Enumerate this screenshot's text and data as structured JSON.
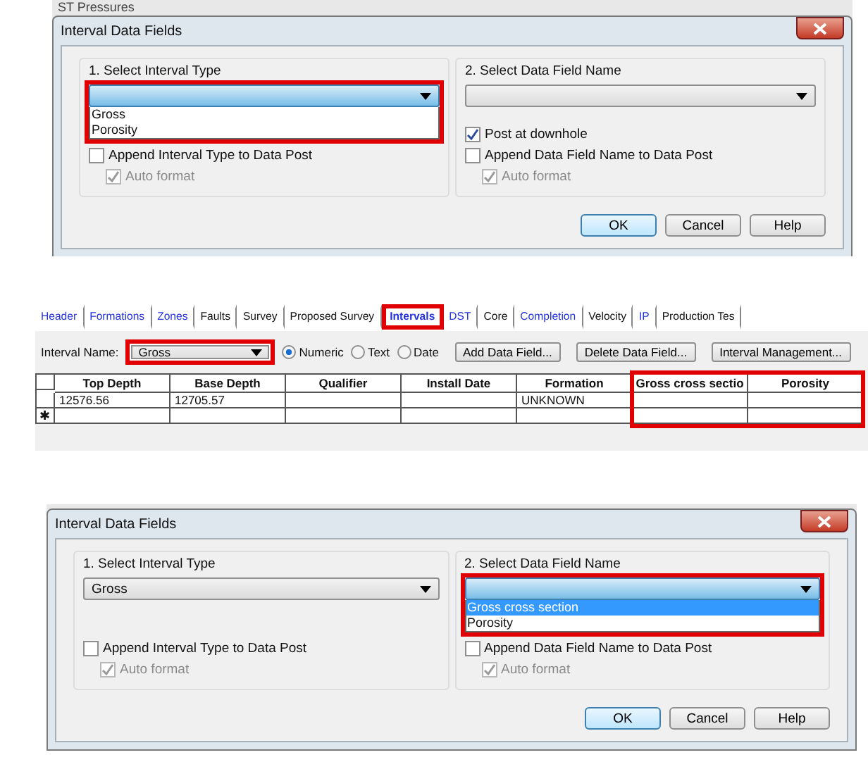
{
  "panels": [
    {
      "kind": "dialog",
      "background_label": "ST Pressures",
      "title": "Interval Data Fields",
      "groups": [
        {
          "label": "1. Select Interval Type",
          "dropdown": {
            "open": true,
            "highlighted": true,
            "options": [
              {
                "label": "Gross",
                "selected": false
              },
              {
                "label": "Porosity",
                "selected": false
              }
            ]
          },
          "checkboxes": [
            {
              "label": "Append Interval Type to Data Post",
              "checked": false,
              "disabled": false,
              "children": [
                {
                  "label": "Auto format",
                  "checked": true,
                  "disabled": true
                }
              ]
            }
          ]
        },
        {
          "label": "2. Select Data Field Name",
          "dropdown": {
            "open": false,
            "highlighted": false
          },
          "checkboxes": [
            {
              "label": "Post at downhole",
              "checked": true,
              "disabled": false
            },
            {
              "label": "Append Data Field Name to Data Post",
              "checked": false,
              "disabled": false,
              "children": [
                {
                  "label": "Auto format",
                  "checked": true,
                  "disabled": true
                }
              ]
            }
          ]
        }
      ],
      "buttons": [
        {
          "label": "OK",
          "default": true
        },
        {
          "label": "Cancel",
          "default": false
        },
        {
          "label": "Help",
          "default": false
        }
      ]
    },
    {
      "kind": "well_editor",
      "tabs": [
        {
          "label": "Header",
          "has_data": true,
          "selected": false,
          "highlighted": false
        },
        {
          "label": "Formations",
          "has_data": true,
          "selected": false,
          "highlighted": false
        },
        {
          "label": "Zones",
          "has_data": true,
          "selected": false,
          "highlighted": false
        },
        {
          "label": "Faults",
          "has_data": false,
          "selected": false,
          "highlighted": false
        },
        {
          "label": "Survey",
          "has_data": false,
          "selected": false,
          "highlighted": false
        },
        {
          "label": "Proposed Survey",
          "has_data": false,
          "selected": false,
          "highlighted": false
        },
        {
          "label": "Intervals",
          "has_data": true,
          "selected": true,
          "highlighted": true
        },
        {
          "label": "DST",
          "has_data": true,
          "selected": false,
          "highlighted": false
        },
        {
          "label": "Core",
          "has_data": false,
          "selected": false,
          "highlighted": false
        },
        {
          "label": "Completion",
          "has_data": true,
          "selected": false,
          "highlighted": false
        },
        {
          "label": "Velocity",
          "has_data": false,
          "selected": false,
          "highlighted": false
        },
        {
          "label": "IP",
          "has_data": true,
          "selected": false,
          "highlighted": false
        },
        {
          "label": "Production Tes",
          "has_data": false,
          "selected": false,
          "highlighted": false
        }
      ],
      "interval_name": {
        "label": "Interval Name:",
        "value": "Gross",
        "highlighted": true
      },
      "radios": [
        {
          "label": "Numeric",
          "selected": true
        },
        {
          "label": "Text",
          "selected": false
        },
        {
          "label": "Date",
          "selected": false
        }
      ],
      "buttons": [
        "Add Data Field...",
        "Delete Data Field...",
        "Interval Management..."
      ],
      "table": {
        "columns": [
          {
            "label": "Top Depth",
            "highlighted": false
          },
          {
            "label": "Base Depth",
            "highlighted": false
          },
          {
            "label": "Qualifier",
            "highlighted": false
          },
          {
            "label": "Install Date",
            "highlighted": false
          },
          {
            "label": "Formation",
            "highlighted": false
          },
          {
            "label": "Gross cross sectio",
            "highlighted": true
          },
          {
            "label": "Porosity",
            "highlighted": true
          }
        ],
        "rows": [
          [
            "12576.56",
            "12705.57",
            "",
            "",
            "UNKNOWN",
            "",
            ""
          ]
        ],
        "new_row_marker": "✱"
      }
    },
    {
      "kind": "dialog",
      "title": "Interval Data Fields",
      "groups": [
        {
          "label": "1. Select Interval Type",
          "dropdown": {
            "value": "Gross",
            "open": false,
            "highlighted": false
          },
          "checkboxes": [
            {
              "label": "Append Interval Type to Data Post",
              "checked": false,
              "disabled": false,
              "children": [
                {
                  "label": "Auto format",
                  "checked": true,
                  "disabled": true
                }
              ]
            }
          ]
        },
        {
          "label": "2. Select Data Field Name",
          "dropdown": {
            "open": true,
            "highlighted": true,
            "options": [
              {
                "label": "Gross cross section",
                "selected": true
              },
              {
                "label": "Porosity",
                "selected": false
              }
            ]
          },
          "checkboxes": [
            {
              "label": "Append Data Field Name to Data Post",
              "checked": false,
              "disabled": false,
              "children": [
                {
                  "label": "Auto format",
                  "checked": true,
                  "disabled": true
                }
              ]
            }
          ]
        }
      ],
      "buttons": [
        {
          "label": "OK",
          "default": true
        },
        {
          "label": "Cancel",
          "default": false
        },
        {
          "label": "Help",
          "default": false
        }
      ]
    }
  ]
}
